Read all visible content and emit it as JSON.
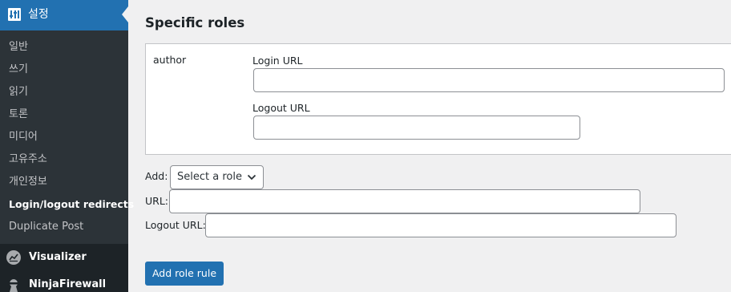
{
  "sidebar": {
    "active_menu": {
      "label": "설정",
      "icon": "settings-sliders-icon"
    },
    "submenu": [
      {
        "label": "일반"
      },
      {
        "label": "쓰기"
      },
      {
        "label": "읽기"
      },
      {
        "label": "토론"
      },
      {
        "label": "미디어"
      },
      {
        "label": "고유주소"
      },
      {
        "label": "개인정보"
      },
      {
        "label": "Login/logout redirects",
        "current": true
      },
      {
        "label": "Duplicate Post"
      }
    ],
    "menu_items": [
      {
        "label": "Visualizer",
        "icon": "chart-icon"
      },
      {
        "label": "NinjaFirewall",
        "icon": "ninja-icon"
      }
    ]
  },
  "main": {
    "section_title": "Specific roles",
    "role_rule": {
      "role": "author",
      "login_url_label": "Login URL",
      "login_url_value": "",
      "logout_url_label": "Logout URL",
      "logout_url_value": ""
    },
    "add_form": {
      "add_label": "Add:",
      "role_select_value": "Select a role",
      "url_label": "URL:",
      "url_value": "",
      "logout_url_label": "Logout URL:",
      "logout_url_value": "",
      "submit_label": "Add role rule"
    }
  },
  "colors": {
    "sidebar_bg": "#1d2327",
    "submenu_bg": "#2c3338",
    "accent": "#2271b1",
    "page_bg": "#f0f0f1"
  }
}
